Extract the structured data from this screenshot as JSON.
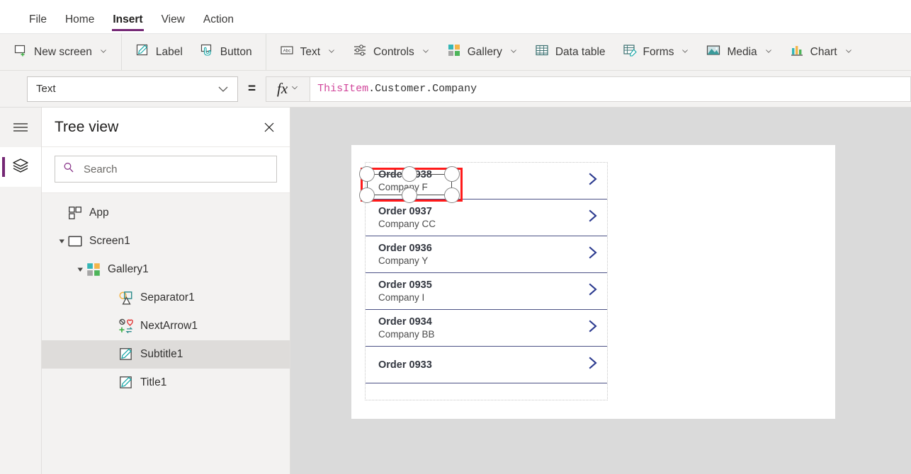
{
  "menu": {
    "tabs": [
      {
        "label": "File",
        "active": false
      },
      {
        "label": "Home",
        "active": false
      },
      {
        "label": "Insert",
        "active": true
      },
      {
        "label": "View",
        "active": false
      },
      {
        "label": "Action",
        "active": false
      }
    ]
  },
  "ribbon": {
    "groups": [
      {
        "items": [
          {
            "label": "New screen",
            "icon": "new-screen-icon",
            "caret": true
          }
        ]
      },
      {
        "items": [
          {
            "label": "Label",
            "icon": "label-icon",
            "caret": false
          },
          {
            "label": "Button",
            "icon": "button-icon",
            "caret": false
          }
        ]
      },
      {
        "items": [
          {
            "label": "Text",
            "icon": "text-abc-icon",
            "caret": true
          },
          {
            "label": "Controls",
            "icon": "controls-sliders-icon",
            "caret": true
          },
          {
            "label": "Gallery",
            "icon": "gallery-squares-icon",
            "caret": true
          },
          {
            "label": "Data table",
            "icon": "data-table-icon",
            "caret": false
          },
          {
            "label": "Forms",
            "icon": "forms-icon",
            "caret": true
          },
          {
            "label": "Media",
            "icon": "media-image-icon",
            "caret": true
          },
          {
            "label": "Chart",
            "icon": "chart-bars-icon",
            "caret": true
          }
        ]
      }
    ]
  },
  "formula_bar": {
    "property": "Text",
    "equals": "=",
    "fx_label": "fx",
    "formula_tokens": [
      {
        "text": "ThisItem",
        "kind": "ident"
      },
      {
        "text": ".Customer.Company",
        "kind": "plain"
      }
    ],
    "formula_full": "ThisItem.Customer.Company"
  },
  "rail": {
    "hamburger": "hamburger-icon",
    "items": [
      {
        "name": "tree-view",
        "icon": "layers-icon",
        "active": true
      }
    ]
  },
  "tree_panel": {
    "title": "Tree view",
    "close_label": "✕",
    "search": {
      "value": "",
      "placeholder": "Search"
    },
    "items": [
      {
        "label": "App",
        "icon": "app-icon",
        "indent": 1,
        "twisty": "",
        "selected": false
      },
      {
        "label": "Screen1",
        "icon": "screen-icon",
        "indent": 1,
        "twisty": "expanded",
        "selected": false
      },
      {
        "label": "Gallery1",
        "icon": "gallery-icon",
        "indent": 2,
        "twisty": "expanded",
        "selected": false
      },
      {
        "label": "Separator1",
        "icon": "separator-icon",
        "indent": 3,
        "twisty": "",
        "selected": false
      },
      {
        "label": "NextArrow1",
        "icon": "nextarrow-icon",
        "indent": 3,
        "twisty": "",
        "selected": false
      },
      {
        "label": "Subtitle1",
        "icon": "label-edit-icon",
        "indent": 3,
        "twisty": "",
        "selected": true
      },
      {
        "label": "Title1",
        "icon": "label-edit-icon",
        "indent": 3,
        "twisty": "",
        "selected": false
      }
    ]
  },
  "canvas": {
    "gallery_rows": [
      {
        "title": "Order 0938",
        "subtitle": "Company F",
        "chevron": true,
        "selected": true
      },
      {
        "title": "Order 0937",
        "subtitle": "Company CC",
        "chevron": true,
        "selected": false
      },
      {
        "title": "Order 0936",
        "subtitle": "Company Y",
        "chevron": true,
        "selected": false
      },
      {
        "title": "Order 0935",
        "subtitle": "Company I",
        "chevron": true,
        "selected": false
      },
      {
        "title": "Order 0934",
        "subtitle": "Company BB",
        "chevron": true,
        "selected": false
      },
      {
        "title": "Order 0933",
        "subtitle": "",
        "chevron": true,
        "selected": false
      }
    ]
  },
  "colors": {
    "accent_purple": "#742774",
    "selection_red": "#ff1a1a",
    "chevron_blue": "#2b3a8f",
    "separator_blue": "#4b5185",
    "formula_ident": "#d1469b",
    "canvas_bg": "#dadada",
    "chrome_bg": "#f3f2f1"
  }
}
